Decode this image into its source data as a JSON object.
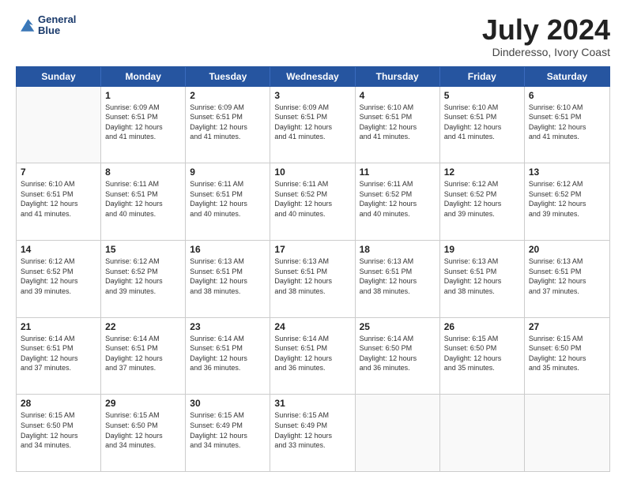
{
  "header": {
    "logo_text_top": "General",
    "logo_text_bottom": "Blue",
    "month_title": "July 2024",
    "location": "Dinderesso, Ivory Coast"
  },
  "calendar": {
    "days": [
      "Sunday",
      "Monday",
      "Tuesday",
      "Wednesday",
      "Thursday",
      "Friday",
      "Saturday"
    ],
    "rows": [
      [
        {
          "date": "",
          "info": ""
        },
        {
          "date": "1",
          "info": "Sunrise: 6:09 AM\nSunset: 6:51 PM\nDaylight: 12 hours\nand 41 minutes."
        },
        {
          "date": "2",
          "info": "Sunrise: 6:09 AM\nSunset: 6:51 PM\nDaylight: 12 hours\nand 41 minutes."
        },
        {
          "date": "3",
          "info": "Sunrise: 6:09 AM\nSunset: 6:51 PM\nDaylight: 12 hours\nand 41 minutes."
        },
        {
          "date": "4",
          "info": "Sunrise: 6:10 AM\nSunset: 6:51 PM\nDaylight: 12 hours\nand 41 minutes."
        },
        {
          "date": "5",
          "info": "Sunrise: 6:10 AM\nSunset: 6:51 PM\nDaylight: 12 hours\nand 41 minutes."
        },
        {
          "date": "6",
          "info": "Sunrise: 6:10 AM\nSunset: 6:51 PM\nDaylight: 12 hours\nand 41 minutes."
        }
      ],
      [
        {
          "date": "7",
          "info": "Sunrise: 6:10 AM\nSunset: 6:51 PM\nDaylight: 12 hours\nand 41 minutes."
        },
        {
          "date": "8",
          "info": "Sunrise: 6:11 AM\nSunset: 6:51 PM\nDaylight: 12 hours\nand 40 minutes."
        },
        {
          "date": "9",
          "info": "Sunrise: 6:11 AM\nSunset: 6:51 PM\nDaylight: 12 hours\nand 40 minutes."
        },
        {
          "date": "10",
          "info": "Sunrise: 6:11 AM\nSunset: 6:52 PM\nDaylight: 12 hours\nand 40 minutes."
        },
        {
          "date": "11",
          "info": "Sunrise: 6:11 AM\nSunset: 6:52 PM\nDaylight: 12 hours\nand 40 minutes."
        },
        {
          "date": "12",
          "info": "Sunrise: 6:12 AM\nSunset: 6:52 PM\nDaylight: 12 hours\nand 39 minutes."
        },
        {
          "date": "13",
          "info": "Sunrise: 6:12 AM\nSunset: 6:52 PM\nDaylight: 12 hours\nand 39 minutes."
        }
      ],
      [
        {
          "date": "14",
          "info": "Sunrise: 6:12 AM\nSunset: 6:52 PM\nDaylight: 12 hours\nand 39 minutes."
        },
        {
          "date": "15",
          "info": "Sunrise: 6:12 AM\nSunset: 6:52 PM\nDaylight: 12 hours\nand 39 minutes."
        },
        {
          "date": "16",
          "info": "Sunrise: 6:13 AM\nSunset: 6:51 PM\nDaylight: 12 hours\nand 38 minutes."
        },
        {
          "date": "17",
          "info": "Sunrise: 6:13 AM\nSunset: 6:51 PM\nDaylight: 12 hours\nand 38 minutes."
        },
        {
          "date": "18",
          "info": "Sunrise: 6:13 AM\nSunset: 6:51 PM\nDaylight: 12 hours\nand 38 minutes."
        },
        {
          "date": "19",
          "info": "Sunrise: 6:13 AM\nSunset: 6:51 PM\nDaylight: 12 hours\nand 38 minutes."
        },
        {
          "date": "20",
          "info": "Sunrise: 6:13 AM\nSunset: 6:51 PM\nDaylight: 12 hours\nand 37 minutes."
        }
      ],
      [
        {
          "date": "21",
          "info": "Sunrise: 6:14 AM\nSunset: 6:51 PM\nDaylight: 12 hours\nand 37 minutes."
        },
        {
          "date": "22",
          "info": "Sunrise: 6:14 AM\nSunset: 6:51 PM\nDaylight: 12 hours\nand 37 minutes."
        },
        {
          "date": "23",
          "info": "Sunrise: 6:14 AM\nSunset: 6:51 PM\nDaylight: 12 hours\nand 36 minutes."
        },
        {
          "date": "24",
          "info": "Sunrise: 6:14 AM\nSunset: 6:51 PM\nDaylight: 12 hours\nand 36 minutes."
        },
        {
          "date": "25",
          "info": "Sunrise: 6:14 AM\nSunset: 6:50 PM\nDaylight: 12 hours\nand 36 minutes."
        },
        {
          "date": "26",
          "info": "Sunrise: 6:15 AM\nSunset: 6:50 PM\nDaylight: 12 hours\nand 35 minutes."
        },
        {
          "date": "27",
          "info": "Sunrise: 6:15 AM\nSunset: 6:50 PM\nDaylight: 12 hours\nand 35 minutes."
        }
      ],
      [
        {
          "date": "28",
          "info": "Sunrise: 6:15 AM\nSunset: 6:50 PM\nDaylight: 12 hours\nand 34 minutes."
        },
        {
          "date": "29",
          "info": "Sunrise: 6:15 AM\nSunset: 6:50 PM\nDaylight: 12 hours\nand 34 minutes."
        },
        {
          "date": "30",
          "info": "Sunrise: 6:15 AM\nSunset: 6:49 PM\nDaylight: 12 hours\nand 34 minutes."
        },
        {
          "date": "31",
          "info": "Sunrise: 6:15 AM\nSunset: 6:49 PM\nDaylight: 12 hours\nand 33 minutes."
        },
        {
          "date": "",
          "info": ""
        },
        {
          "date": "",
          "info": ""
        },
        {
          "date": "",
          "info": ""
        }
      ]
    ]
  }
}
